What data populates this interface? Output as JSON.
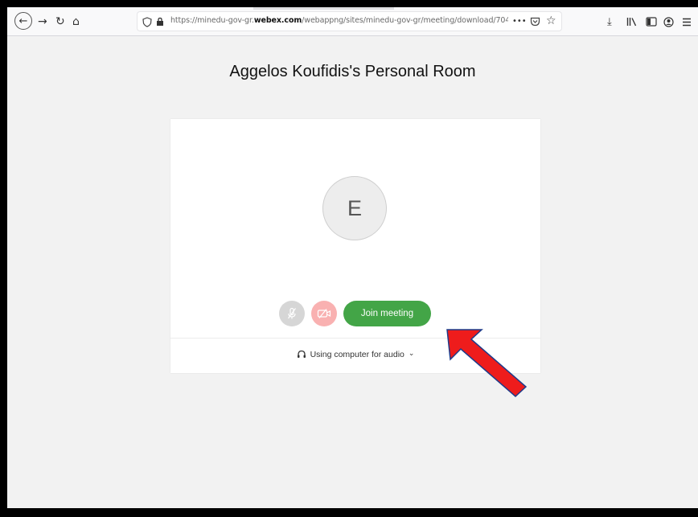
{
  "browser": {
    "back_icon": "back-arrow-icon",
    "url": {
      "prefix": "https://minedu-gov-gr.",
      "domain": "webex.com",
      "path": "/webappng/sites/minedu-gov-gr/meeting/download/7045ea7cb..."
    },
    "more_label": "•••"
  },
  "page": {
    "title": "Aggelos Koufidis's Personal Room"
  },
  "card": {
    "avatar_initial": "E",
    "join_label": "Join meeting",
    "audio_label": "Using computer for audio",
    "audio_chevron": "⌄"
  },
  "colors": {
    "join": "#43a547",
    "video_off": "#f9b1b1",
    "mute": "#d6d6d6",
    "annotation_arrow": "#ee1c1c"
  }
}
